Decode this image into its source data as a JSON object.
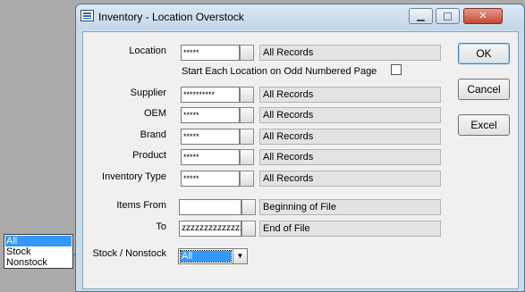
{
  "window": {
    "title": "Inventory - Location Overstock",
    "minimize_glyph": "▁",
    "maximize_glyph": "□",
    "close_glyph": "✕"
  },
  "form": {
    "location": {
      "label": "Location",
      "value": "*****",
      "description": "All Records"
    },
    "odd_page": {
      "label": "Start Each Location on Odd Numbered Page",
      "checked": false
    },
    "supplier": {
      "label": "Supplier",
      "value": "**********",
      "description": "All Records"
    },
    "oem": {
      "label": "OEM",
      "value": "*****",
      "description": "All Records"
    },
    "brand": {
      "label": "Brand",
      "value": "*****",
      "description": "All Records"
    },
    "product": {
      "label": "Product",
      "value": "*****",
      "description": "All Records"
    },
    "inventory_type": {
      "label": "Inventory Type",
      "value": "*****",
      "description": "All Records"
    },
    "items_from": {
      "label": "Items From",
      "value": "",
      "description": "Beginning of File"
    },
    "items_to": {
      "label": "To",
      "value": "zzzzzzzzzzzzzz",
      "description": "End of File"
    },
    "stock_nonstock": {
      "label": "Stock / Nonstock",
      "value": "All"
    }
  },
  "buttons": {
    "ok": "OK",
    "cancel": "Cancel",
    "excel": "Excel"
  },
  "dropdown_options": [
    "All",
    "Stock",
    "Nonstock"
  ],
  "colors": {
    "selection": "#3399ff",
    "pointer_arrow": "#4a78c8"
  }
}
